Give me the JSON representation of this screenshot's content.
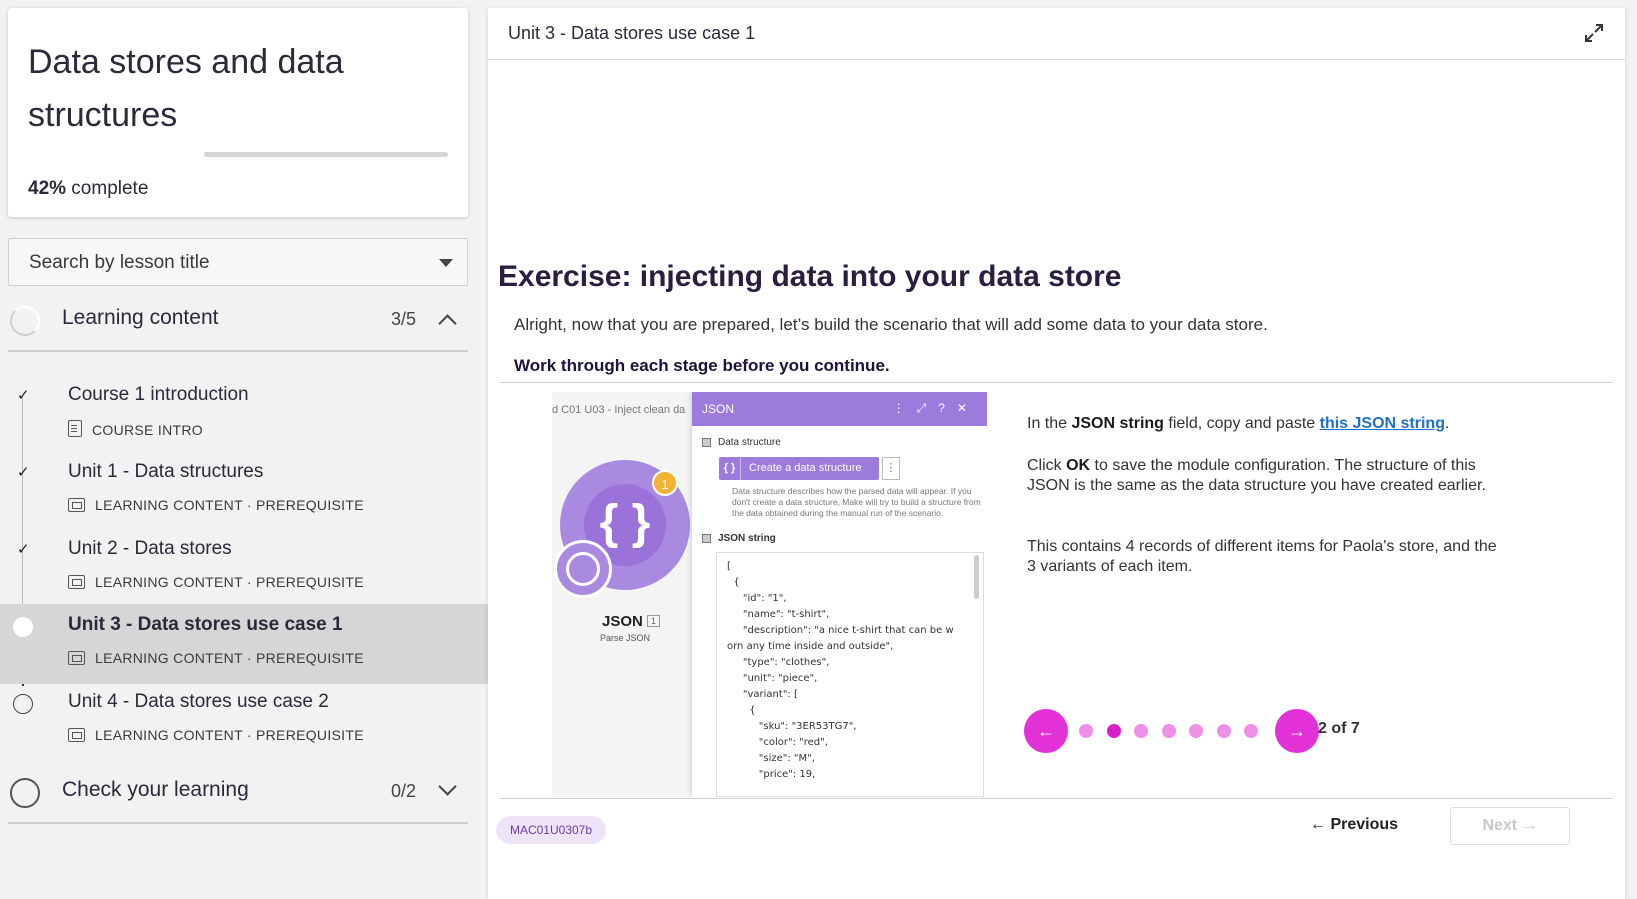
{
  "course": {
    "title": "Data stores and data structures",
    "progress_percent": 42,
    "progress_pct_label": "42%",
    "progress_suffix": " complete"
  },
  "search": {
    "placeholder": "Search by lesson title"
  },
  "sections": [
    {
      "label": "Learning content",
      "count": "3/5",
      "expanded": true
    },
    {
      "label": "Check your learning",
      "count": "0/2",
      "expanded": false
    }
  ],
  "lessons": [
    {
      "title": "Course 1 introduction",
      "meta": "COURSE INTRO",
      "status": "complete"
    },
    {
      "title": "Unit 1 - Data structures",
      "meta": "LEARNING CONTENT · PREREQUISITE",
      "status": "complete"
    },
    {
      "title": "Unit 2 - Data stores",
      "meta": "LEARNING CONTENT · PREREQUISITE",
      "status": "complete"
    },
    {
      "title": "Unit 3 - Data stores use case 1",
      "meta": "LEARNING CONTENT · PREREQUISITE",
      "status": "current"
    },
    {
      "title": "Unit 4 - Data stores use case 2",
      "meta": "LEARNING CONTENT · PREREQUISITE",
      "status": "not-started"
    }
  ],
  "main": {
    "unit_title": "Unit 3 - Data stores use case 1",
    "exercise_title": "Exercise: injecting data into your data store",
    "intro": "Alright, now that you are prepared, let’s build the scenario that will add some data to your data store.",
    "instruction": "Work through each stage before you continue."
  },
  "screenshot": {
    "caption": "d C01 U03 - Inject clean da",
    "badge": "1",
    "module_name": "JSON",
    "module_num": "1",
    "module_sub": "Parse JSON",
    "dialog_title": "JSON",
    "data_structure_label": "Data structure",
    "create_button": "Create a data structure",
    "hint": "Data structure describes how the parsed data will appear. If you don't create a data structure, Make will try to build a structure from the data obtained during the manual run of the scenario.",
    "json_string_label": "JSON string",
    "code": "[\n  {\n     \"id\": \"1\",\n     \"name\": \"t-shirt\",\n     \"description\": \"a nice t-shirt that can be w\norn any time inside and outside\",\n     \"type\": \"clothes\",\n     \"unit\": \"piece\",\n     \"variant\": [\n       {\n          \"sku\": \"3ER53TG7\",\n          \"color\": \"red\",\n          \"size\": \"M\",\n          \"price\": 19,"
  },
  "step_text": {
    "p1_pre": "In the ",
    "p1_bold": "JSON string",
    "p1_mid": " field, copy and paste ",
    "p1_link": "this JSON string",
    "p1_end": ".",
    "p2_pre": "Click ",
    "p2_bold": "OK",
    "p2_rest": " to save the module configuration. The structure of this JSON is the same as the data structure you have created earlier.",
    "p3": "This contains 4 records of different items for Paola's store, and the 3 variants of each item."
  },
  "carousel": {
    "current": 2,
    "total": 7,
    "label": "2 of 7"
  },
  "footer": {
    "code": "MAC01U0307b",
    "previous_label": "← Previous",
    "next_label": "Next →"
  },
  "colors": {
    "accent": "#e232d7",
    "dot_inactive": "#ee8fe8",
    "title_purple": "#2b1d3d",
    "link": "#1f6fd1"
  }
}
